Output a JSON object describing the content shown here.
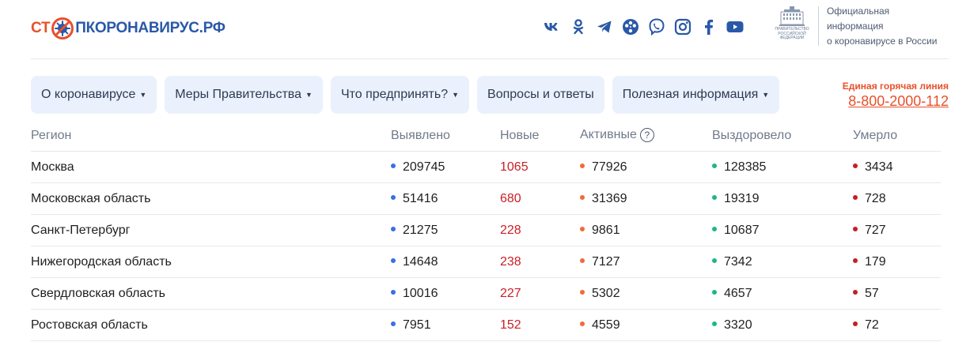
{
  "brand": {
    "logo_part1": "СТ",
    "logo_part2": "ПКОРОНАВИРУС.РФ"
  },
  "socials": [
    "vk-icon",
    "odnoklassniki-icon",
    "telegram-icon",
    "film-reel-icon",
    "viber-icon",
    "instagram-icon",
    "facebook-icon",
    "youtube-icon"
  ],
  "gov": {
    "emblem_text": "ПРАВИТЕЛЬСТВО РОССИЙСКОЙ ФЕДЕРАЦИИ",
    "line1": "Официальная информация",
    "line2": "о коронавирусе в России"
  },
  "nav": [
    {
      "label": "О коронавирусе",
      "dropdown": true
    },
    {
      "label": "Меры Правительства",
      "dropdown": true
    },
    {
      "label": "Что предпринять?",
      "dropdown": true
    },
    {
      "label": "Вопросы и ответы",
      "dropdown": false
    },
    {
      "label": "Полезная информация",
      "dropdown": true
    }
  ],
  "hotline": {
    "label": "Единая горячая линия",
    "phone": "8-800-2000-112"
  },
  "table": {
    "headers": {
      "region": "Регион",
      "detected": "Выявлено",
      "new": "Новые",
      "active": "Активные",
      "active_help": "?",
      "recovered": "Выздоровело",
      "died": "Умерло"
    },
    "rows": [
      {
        "region": "Москва",
        "detected": "209745",
        "new": "1065",
        "active": "77926",
        "recovered": "128385",
        "died": "3434"
      },
      {
        "region": "Московская область",
        "detected": "51416",
        "new": "680",
        "active": "31369",
        "recovered": "19319",
        "died": "728"
      },
      {
        "region": "Санкт-Петербург",
        "detected": "21275",
        "new": "228",
        "active": "9861",
        "recovered": "10687",
        "died": "727"
      },
      {
        "region": "Нижегородская область",
        "detected": "14648",
        "new": "238",
        "active": "7127",
        "recovered": "7342",
        "died": "179"
      },
      {
        "region": "Свердловская область",
        "detected": "10016",
        "new": "227",
        "active": "5302",
        "recovered": "4657",
        "died": "57"
      },
      {
        "region": "Ростовская область",
        "detected": "7951",
        "new": "152",
        "active": "4559",
        "recovered": "3320",
        "died": "72"
      }
    ]
  },
  "colors": {
    "brand_red": "#e8502b",
    "brand_blue": "#2a58a8",
    "nav_bg": "#eaf1fc",
    "new_value": "#c91f26",
    "dot_detected": "#3a6ee8",
    "dot_active": "#f06a3c",
    "dot_recovered": "#1fb58a",
    "dot_died": "#c41f22"
  }
}
